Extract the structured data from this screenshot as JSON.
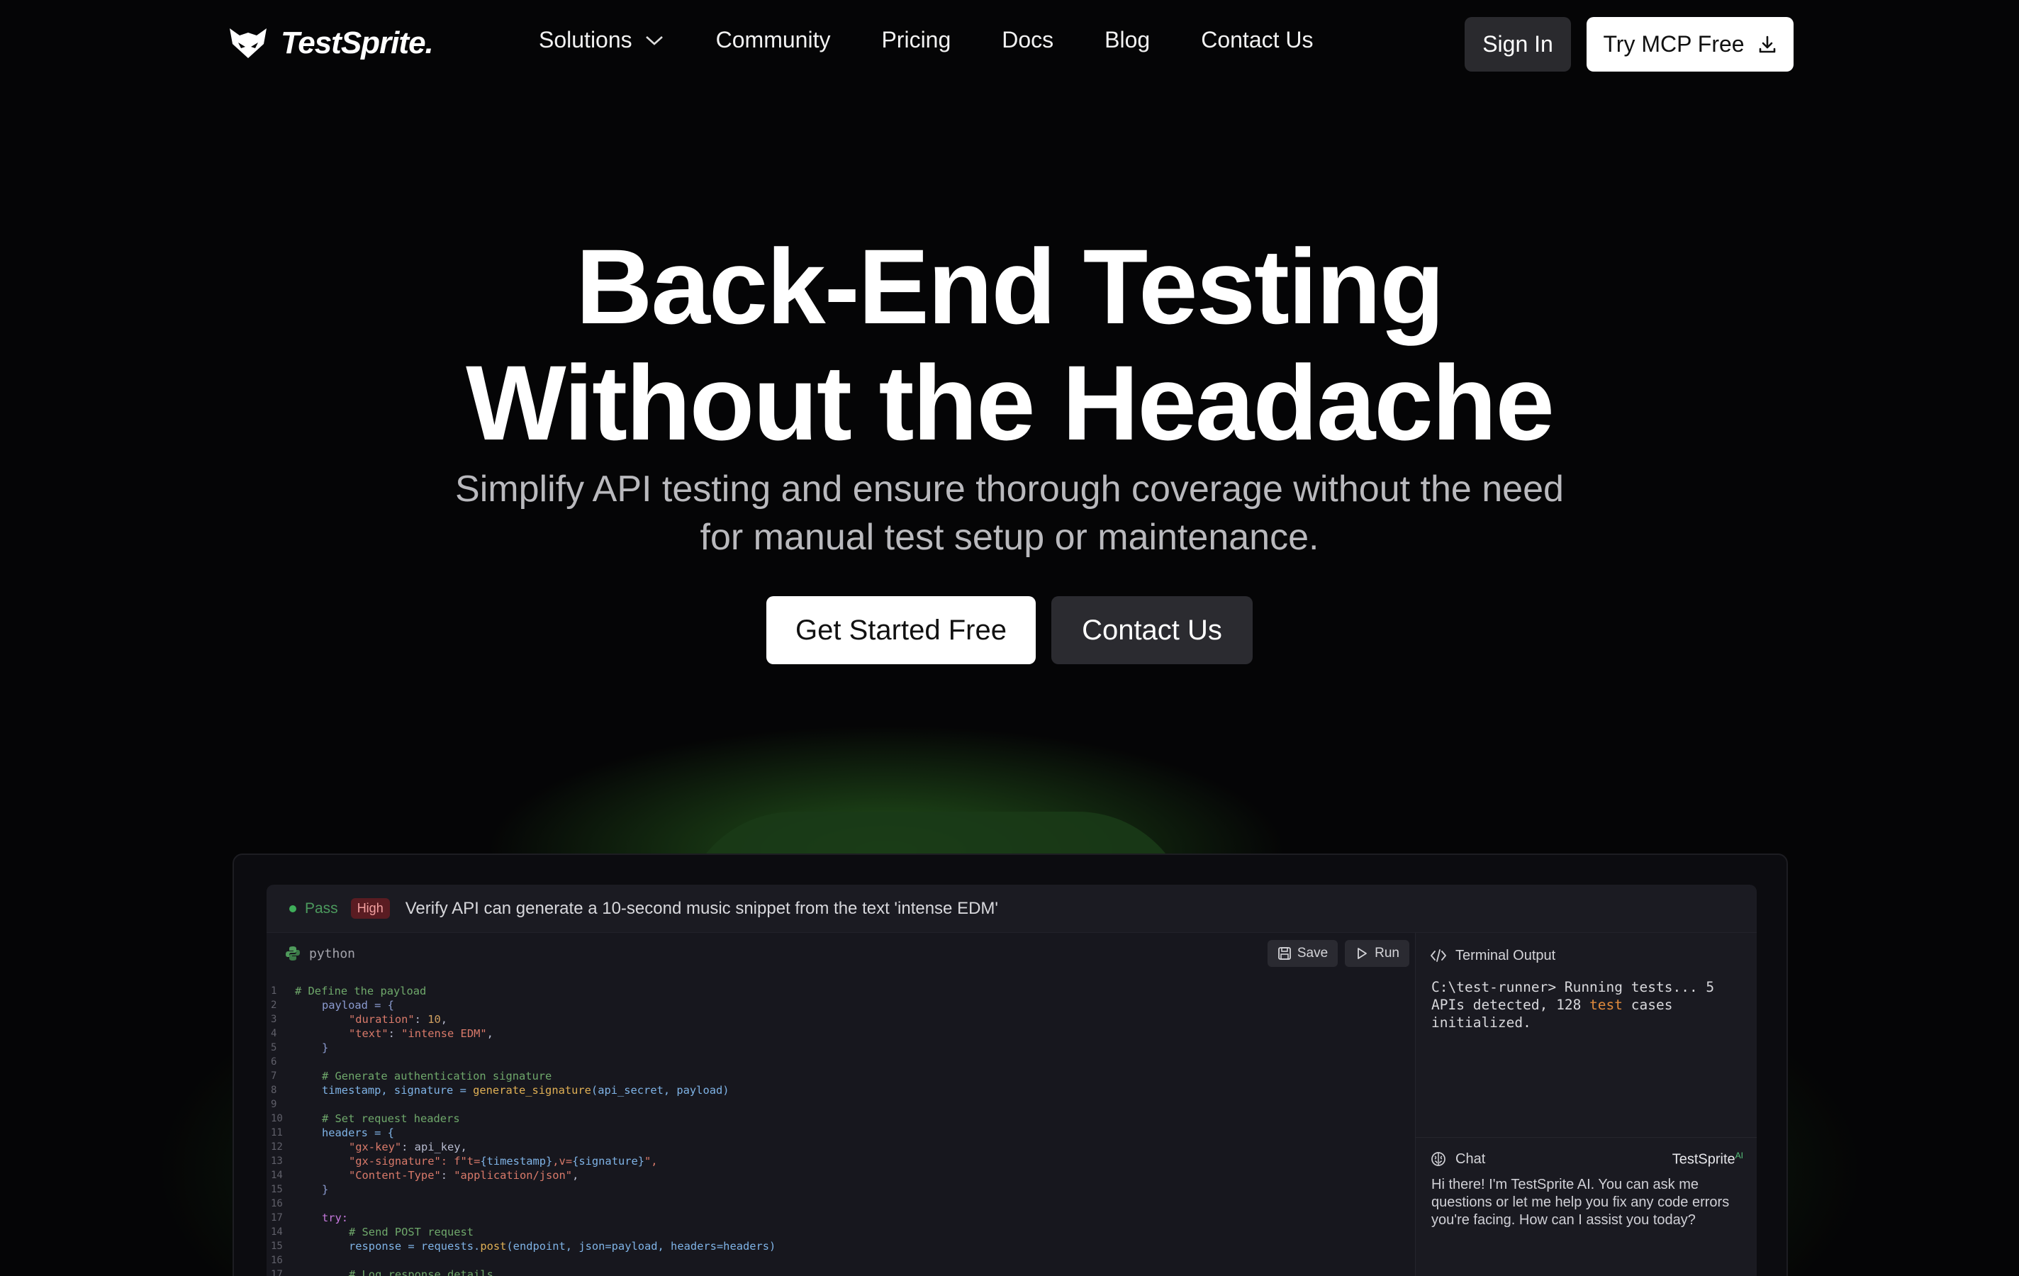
{
  "nav": {
    "logo_text": "TestSprite.",
    "links": [
      {
        "label": "Solutions"
      },
      {
        "label": "Community"
      },
      {
        "label": "Pricing"
      },
      {
        "label": "Docs"
      },
      {
        "label": "Blog"
      },
      {
        "label": "Contact Us"
      }
    ],
    "sign_in": "Sign In",
    "try_mcp": "Try MCP Free"
  },
  "hero": {
    "title_line1": "Back-End Testing",
    "title_line2": "Without the Headache",
    "subtitle_line1": "Simplify API testing and ensure thorough coverage without the need",
    "subtitle_line2": "for manual test setup or maintenance.",
    "cta_primary": "Get Started Free",
    "cta_secondary": "Contact Us"
  },
  "demo": {
    "status": "Pass",
    "priority": "High",
    "test_title": "Verify API can generate a 10-second music snippet from the text 'intense EDM'",
    "language": "python",
    "save_label": "Save",
    "run_label": "Run",
    "terminal_title": "Terminal Output",
    "terminal_pre": "C:\\test-runner> Running tests... 5 APIs detected, 128 ",
    "terminal_hl": "test",
    "terminal_post": " cases initialized.",
    "chat_title": "Chat",
    "chat_brand": "TestSprite",
    "chat_brand_sup": "AI",
    "chat_message": "Hi there! I'm TestSprite AI. You can ask me questions or let me help you fix any code errors you're facing. How can I assist you today?",
    "code_lines": [
      {
        "n": "1"
      },
      {
        "n": "2"
      },
      {
        "n": "3"
      },
      {
        "n": "4"
      },
      {
        "n": "5"
      },
      {
        "n": "6"
      },
      {
        "n": "7"
      },
      {
        "n": "8"
      },
      {
        "n": "9"
      },
      {
        "n": "10"
      },
      {
        "n": "11"
      },
      {
        "n": "12"
      },
      {
        "n": "13"
      },
      {
        "n": "14"
      },
      {
        "n": "15"
      },
      {
        "n": "16"
      },
      {
        "n": "17"
      }
    ],
    "code": {
      "l1": "# Define the payload",
      "l2a": "payload = {",
      "l3a": "\"duration\"",
      "l3b": ": ",
      "l3c": "10",
      "l3d": ",",
      "l4a": "\"text\"",
      "l4b": ": ",
      "l4c": "\"intense EDM\"",
      "l4d": ",",
      "l5": "}",
      "l7": "# Generate authentication signature",
      "l8a": "timestamp, signature = ",
      "l8b": "generate_signature",
      "l8c": "(api_secret, payload)",
      "l10": "# Set request headers",
      "l11": "headers = {",
      "l12a": "\"gx-key\"",
      "l12b": ": api_key,",
      "l13a": "\"gx-signature\"",
      "l13b": ": f\"t=",
      "l13c": "{timestamp}",
      "l13d": ",v=",
      "l13e": "{signature}",
      "l13f": "\",",
      "l14a": "\"Content-Type\"",
      "l14b": ": ",
      "l14c": "\"application/json\"",
      "l14d": ",",
      "l15": "}",
      "l17": "try:",
      "l18": "# Send POST request",
      "l19a": "response = requests.",
      "l19b": "post",
      "l19c": "(endpoint, json=payload, headers=headers)",
      "l21": "# Log response details"
    }
  }
}
